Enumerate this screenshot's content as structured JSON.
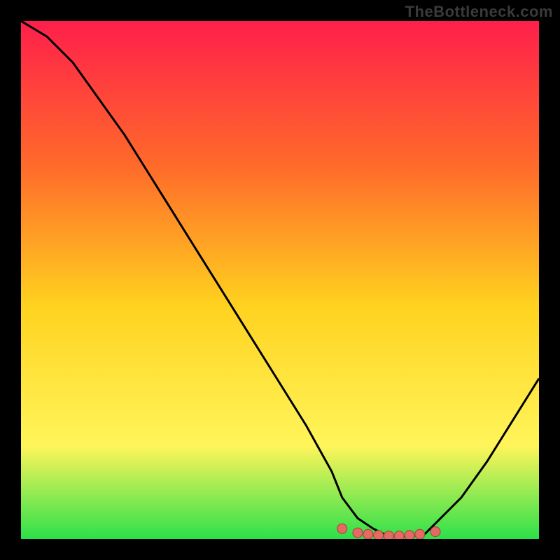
{
  "watermark": "TheBottleneck.com",
  "colors": {
    "background": "#000000",
    "gradient_top": "#ff1f4b",
    "gradient_mid_upper": "#ff6a2a",
    "gradient_mid": "#ffd21f",
    "gradient_lower": "#fff55a",
    "gradient_bottom": "#2de04a",
    "curve": "#000000",
    "marker_fill": "#e46a63",
    "marker_stroke": "#a93f3a"
  },
  "chart_data": {
    "type": "line",
    "title": "",
    "xlabel": "",
    "ylabel": "",
    "xlim": [
      0,
      100
    ],
    "ylim": [
      0,
      100
    ],
    "series": [
      {
        "name": "bottleneck-curve",
        "x": [
          0,
          5,
          10,
          15,
          20,
          25,
          30,
          35,
          40,
          45,
          50,
          55,
          60,
          62,
          65,
          68,
          70,
          72,
          75,
          78,
          80,
          85,
          90,
          95,
          100
        ],
        "y": [
          100,
          97,
          92,
          85,
          78,
          70,
          62,
          54,
          46,
          38,
          30,
          22,
          13,
          8,
          4,
          2,
          1,
          0.5,
          0.5,
          1,
          3,
          8,
          15,
          23,
          31
        ]
      }
    ],
    "markers": {
      "name": "highlight-dots",
      "x": [
        62,
        65,
        67,
        69,
        71,
        73,
        75,
        77,
        80
      ],
      "y": [
        2.0,
        1.2,
        0.9,
        0.7,
        0.6,
        0.6,
        0.7,
        0.9,
        1.4
      ]
    }
  }
}
